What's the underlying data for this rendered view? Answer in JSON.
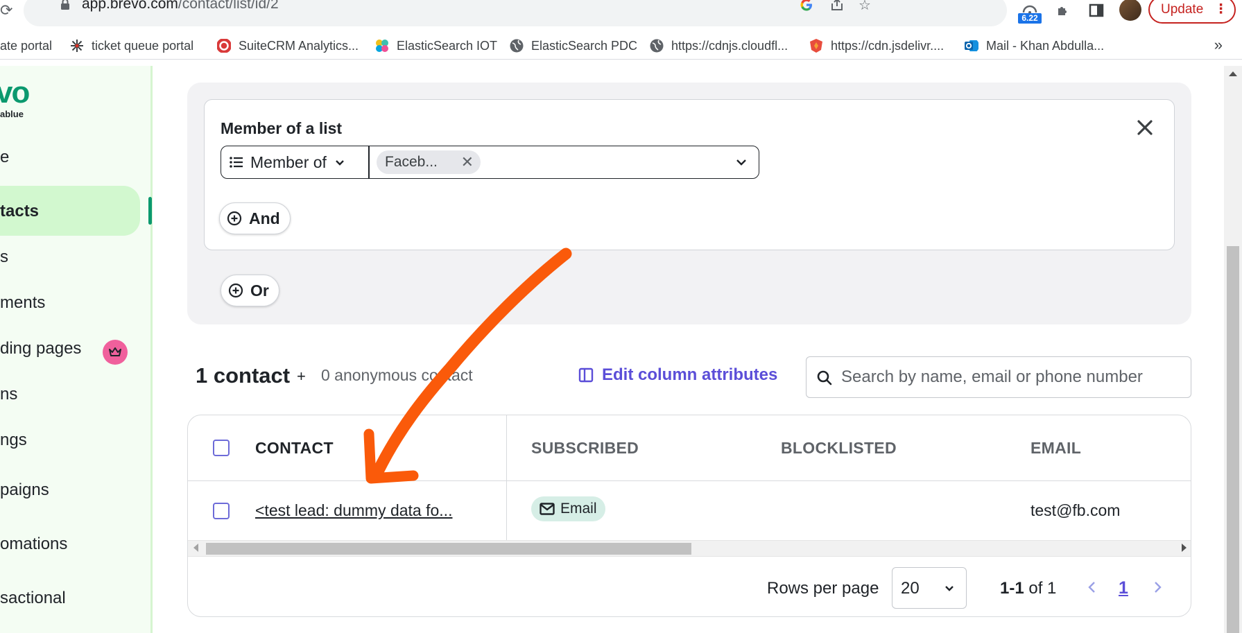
{
  "browser": {
    "url_host": "app.brevo.com",
    "url_path": "/contact/list/id/2",
    "extension_badge": "6.22",
    "update_label": "Update",
    "more_label": "⋮",
    "bookmarks": [
      {
        "label": "ate portal",
        "icon": "none"
      },
      {
        "label": "ticket queue portal",
        "icon": "spark-icon"
      },
      {
        "label": "SuiteCRM Analytics...",
        "icon": "suitecrm-icon"
      },
      {
        "label": "ElasticSearch IOT",
        "icon": "elastic-icon"
      },
      {
        "label": "ElasticSearch PDC",
        "icon": "globe-icon"
      },
      {
        "label": "https://cdnjs.cloudfl...",
        "icon": "globe-icon"
      },
      {
        "label": "https://cdn.jsdelivr....",
        "icon": "jsdelivr-icon"
      },
      {
        "label": "Mail - Khan Abdulla...",
        "icon": "outlook-icon"
      }
    ],
    "bookmarks_more": "»"
  },
  "sidebar": {
    "logo": "vo",
    "logo_sub": "ablue",
    "items": [
      {
        "label": "e"
      },
      {
        "label": "tacts",
        "active": true
      },
      {
        "label": "s"
      },
      {
        "label": "ments"
      },
      {
        "label": "ding pages",
        "premium": true
      },
      {
        "label": "ns"
      },
      {
        "label": "ngs"
      },
      {
        "label": "paigns"
      },
      {
        "label": "omations"
      },
      {
        "label": "sactional"
      }
    ]
  },
  "filter": {
    "title": "Member of a list",
    "operator": "Member of",
    "chip": "Faceb...",
    "chip_remove": "✕",
    "and_label": "And",
    "or_label": "Or"
  },
  "contacts": {
    "count": "1 contact",
    "plus": "+",
    "anonymous": "0 anonymous contact",
    "edit_columns": "Edit column attributes",
    "search_placeholder": "Search by name, email or phone number",
    "columns": [
      "CONTACT",
      "SUBSCRIBED",
      "BLOCKLISTED",
      "EMAIL"
    ],
    "rows": [
      {
        "contact": "<test lead: dummy data fo...",
        "subscribed": "Email",
        "blocklisted": "",
        "email": "test@fb.com"
      }
    ],
    "rows_per_page_label": "Rows per page",
    "rows_per_page": "20",
    "range_bold": "1-1",
    "range_rest": " of 1",
    "current_page": "1"
  },
  "colors": {
    "brand_green": "#0b996e",
    "active_bg": "#d2f8cf",
    "accent_purple": "#5b4ed8",
    "annotation_orange": "#fa5a0a"
  }
}
